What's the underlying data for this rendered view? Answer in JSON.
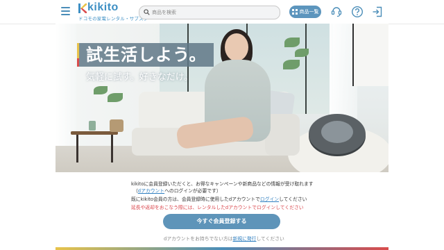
{
  "header": {
    "logo_word": "kikito",
    "logo_tagline": "ドコモの家電レンタル・サブスク",
    "search_placeholder": "商品を検索",
    "catalog_label": "商品一覧",
    "icons": [
      "menu-icon",
      "search-icon",
      "grid-icon",
      "support-icon",
      "help-icon",
      "login-icon"
    ]
  },
  "hero": {
    "title": "試生活しよう。",
    "subtitle": "気軽に試す。好きなだけ。"
  },
  "info": {
    "line1": "kikitoに会員登録いただくと、お得なキャンペーンや新商品などの情報が受け取れます",
    "line2_pre": "（",
    "line2_link": "dアカウント",
    "line2_post": "へのログインが必要です）",
    "line3_pre": "既にkikito会員の方は、会員登録時に使用したdアカウントで",
    "line3_link": "ログイン",
    "line3_post": "してください",
    "line4": "延長や返却をおこなう際には、レンタルしたdアカウントでログインしてください",
    "register_label": "今すぐ会員登録する",
    "footer_pre": "dアカウントをお持ちでない方は",
    "footer_link": "新規に発行",
    "footer_post": "してください"
  },
  "colors": {
    "brand": "#3d8fc4",
    "button": "#5e94b9",
    "link": "#2f7fc0",
    "warning": "#d9444a"
  }
}
